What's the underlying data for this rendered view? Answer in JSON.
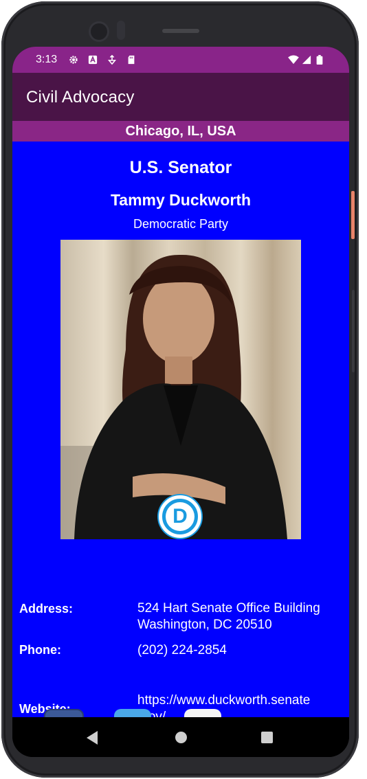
{
  "status_bar": {
    "time": "3:13",
    "left_icons": [
      "gear-icon",
      "a-box-icon",
      "usb-debug-icon",
      "sd-card-icon"
    ],
    "right_icons": [
      "wifi-icon",
      "signal-icon",
      "battery-icon"
    ]
  },
  "app_bar": {
    "title": "Civil Advocacy"
  },
  "location": "Chicago, IL, USA",
  "official": {
    "office": "U.S. Senator",
    "name": "Tammy Duckworth",
    "party": "Democratic Party",
    "party_logo_letter": "D",
    "address_label": "Address:",
    "address_line1": "524 Hart Senate Office Building",
    "address_line2": "Washington, DC 20510",
    "phone_label": "Phone:",
    "phone": "(202) 224-2854",
    "website_label": "Website:",
    "website_line1": "https://www.duckworth.senate",
    "website_line2": ".gov/"
  },
  "social_icons": [
    "facebook-icon",
    "twitter-icon",
    "youtube-icon"
  ],
  "nav_bar": [
    "back-icon",
    "home-icon",
    "recents-icon"
  ],
  "colors": {
    "status_bar": "#892489",
    "app_bar": "#4a1447",
    "location_bar": "#8a2686",
    "content_bg": "#0000ff",
    "party_blue": "#1a9be0"
  }
}
